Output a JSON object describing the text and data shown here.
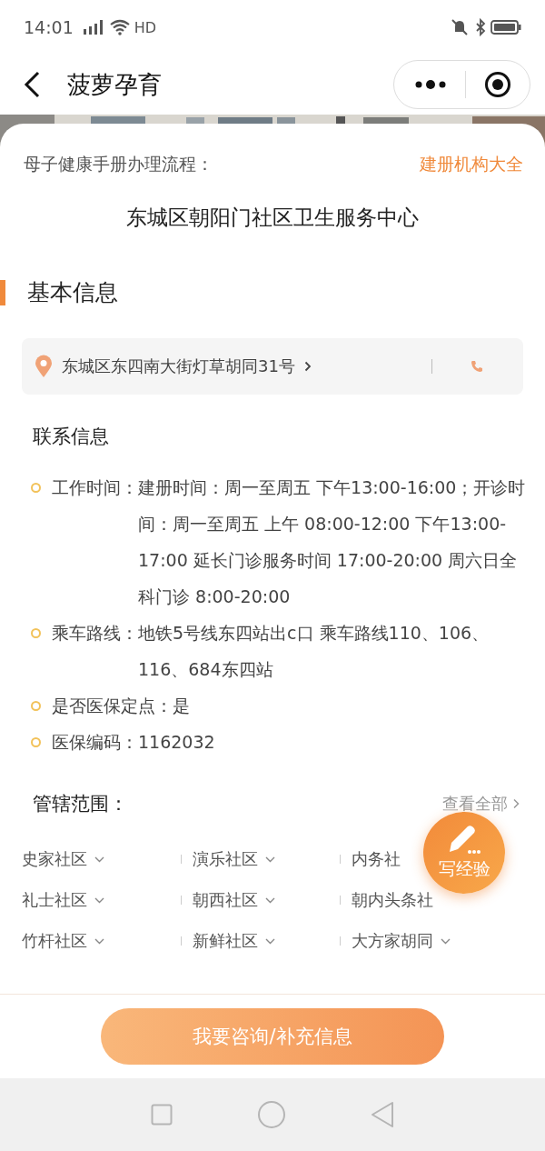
{
  "status_bar": {
    "time": "14:01",
    "network": "HD"
  },
  "nav": {
    "title": "菠萝孕育"
  },
  "header": {
    "subtitle": "母子健康手册办理流程：",
    "link": "建册机构大全",
    "name": "东城区朝阳门社区卫生服务中心"
  },
  "section": {
    "title": "基本信息"
  },
  "address": {
    "text": "东城区东四南大街灯草胡同31号"
  },
  "contact": {
    "title": "联系信息",
    "items": [
      {
        "label": "工作时间：",
        "value": "建册时间：周一至周五 下午13:00-16:00；开诊时间：周一至周五 上午 08:00-12:00 下午13:00-17:00 延长门诊服务时间 17:00-20:00 周六日全科门诊 8:00-20:00"
      },
      {
        "label": "乘车路线：",
        "value": "地铁5号线东四站出c口 乘车路线110、106、116、684东四站"
      },
      {
        "label": "是否医保定点：",
        "value": "是"
      },
      {
        "label": "医保编码：",
        "value": "1162032"
      }
    ]
  },
  "coverage": {
    "title": "管辖范围：",
    "link": "查看全部",
    "items": [
      {
        "name": "史家社区",
        "chevron": true
      },
      {
        "name": "演乐社区",
        "chevron": true
      },
      {
        "name": "内务社",
        "chevron": false
      },
      {
        "name": "礼士社区",
        "chevron": true
      },
      {
        "name": "朝西社区",
        "chevron": true
      },
      {
        "name": "朝内头条社",
        "chevron": false
      },
      {
        "name": "竹杆社区",
        "chevron": true
      },
      {
        "name": "新鲜社区",
        "chevron": true
      },
      {
        "name": "大方家胡同",
        "chevron": true
      }
    ]
  },
  "fab": {
    "label": "写经验"
  },
  "bottom_button": {
    "label": "我要咨询/补充信息"
  }
}
